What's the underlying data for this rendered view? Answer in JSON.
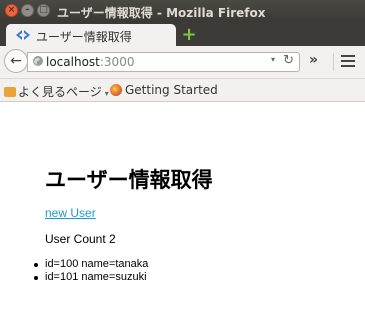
{
  "window": {
    "title": "ユーザー情報取得 - Mozilla Firefox",
    "controls": {
      "close": "×",
      "minimize": "–",
      "maximize": "□"
    }
  },
  "tabs": [
    {
      "label": "ユーザー情報取得",
      "favicon": "dev-tools-icon"
    }
  ],
  "new_tab": {
    "icon": "plus-icon",
    "label": "+"
  },
  "navigation": {
    "back": {
      "icon": "back-arrow-icon",
      "glyph": "←"
    },
    "url": {
      "host": "localhost",
      "port": ":3000"
    },
    "dropdown_glyph": "▾",
    "reload_glyph": "↻",
    "overflow_glyph": "»"
  },
  "bookmarks": [
    {
      "label": "よく見るページ",
      "icon": "folder-icon",
      "caret": "▾"
    },
    {
      "label": "Getting Started",
      "icon": "firefox-icon"
    }
  ],
  "page": {
    "heading": "ユーザー情報取得",
    "new_user_link": "new User",
    "user_count": "User Count 2",
    "users": [
      {
        "text": "id=100 name=tanaka"
      },
      {
        "text": "id=101 name=suzuki"
      }
    ]
  },
  "colors": {
    "link": "#1a9bd6",
    "titlebar": "#3c3b37",
    "toolbar": "#f2f1f0",
    "close_button": "#f1633a",
    "new_tab_plus": "#7ec63e"
  }
}
